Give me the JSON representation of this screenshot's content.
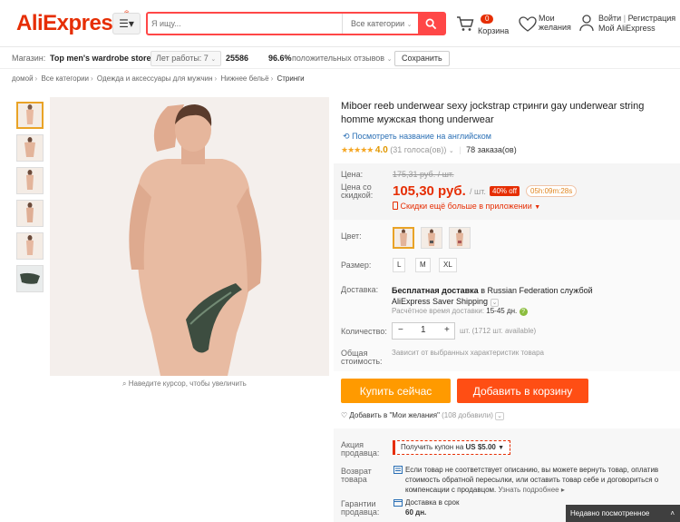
{
  "header": {
    "logo": "AliExpress",
    "logo_tm": "®",
    "category_icon": "menu-icon",
    "search": {
      "placeholder": "Я ищу...",
      "category": "Все категории"
    },
    "cart": {
      "count": "0",
      "label": "Корзина"
    },
    "wishlist": {
      "label": "Мои желания"
    },
    "account": {
      "login": "Войти",
      "separator": "|",
      "register": "Регистрация",
      "my": "Мой AliExpress"
    }
  },
  "store_bar": {
    "label": "Магазин:",
    "name": "Top men's wardrobe store",
    "hours": "Лет работы: 7",
    "score": "25586",
    "positive": "96.6%",
    "positive_label": "положительных отзывов",
    "save": "Сохранить"
  },
  "breadcrumb": [
    "домой",
    "Все категории",
    "Одежда и аксессуары для мужчин",
    "Нижнее бельё",
    "Стринги"
  ],
  "gallery": {
    "zoom_hint": "Наведите курсор, чтобы увеличить",
    "thumb_count": 6
  },
  "product": {
    "title": "Miboer reeb underwear sexy jockstrap стринги gay underwear string homme мужская thong underwear",
    "translate": "Посмотреть название на английском",
    "rating": "4.0",
    "votes": "(31 голоса(ов))",
    "orders": "78 заказа(ов)",
    "stars": "★★★★★"
  },
  "price": {
    "price_label": "Цена:",
    "old": "175,31 руб. / шт.",
    "discount_label_1": "Цена со",
    "discount_label_2": "скидкой:",
    "new": "105,30 руб.",
    "per_unit": "/ шт.",
    "discount": "40% off",
    "timer": "05h:09m:28s",
    "app_promo": "Скидки ещё больше в приложении"
  },
  "options": {
    "color_label": "Цвет:",
    "size_label": "Размер:",
    "sizes": [
      "L",
      "M",
      "XL"
    ]
  },
  "shipping": {
    "label": "Доставка:",
    "line1_bold": "Бесплатная доставка",
    "line1_rest": " в Russian Federation службой",
    "line2": "AliExpress Saver Shipping",
    "time_label": "Расчётное время доставки:",
    "time_value": "15-45 дн."
  },
  "quantity": {
    "label": "Количество:",
    "value": "1",
    "available": "шт. (1712 шт. available)"
  },
  "total": {
    "label_1": "Общая",
    "label_2": "стоимость:",
    "note": "Зависит от выбранных характеристик товара"
  },
  "actions": {
    "buy_now": "Купить сейчас",
    "add_to_cart": "Добавить в корзину",
    "wishlist_add": "Добавить в \"Мои желания\"",
    "wishlist_count": "(108 добавили)"
  },
  "promo": {
    "label_1": "Акция",
    "label_2": "продавца:",
    "coupon_text": "Получить купон на",
    "coupon_value": "US $5.00"
  },
  "returns": {
    "label_1": "Возврат",
    "label_2": "товара",
    "text": "Если товар не соответствует описанию, вы можете вернуть товар, оплатив стоимость обратной пересылки, или оставить товар себе и договориться о компенсации с продавцом.",
    "more": "Узнать подробнее"
  },
  "guarantee": {
    "label_1": "Гарантии",
    "label_2": "продавца:",
    "text": "Доставка в срок",
    "days": "60 дн."
  },
  "recently_viewed": "Недавно посмотренное",
  "colors": {
    "brand": "#e62e04",
    "buy": "#ff9a00",
    "cart": "#ff4e14",
    "link": "#2a6fb5"
  }
}
